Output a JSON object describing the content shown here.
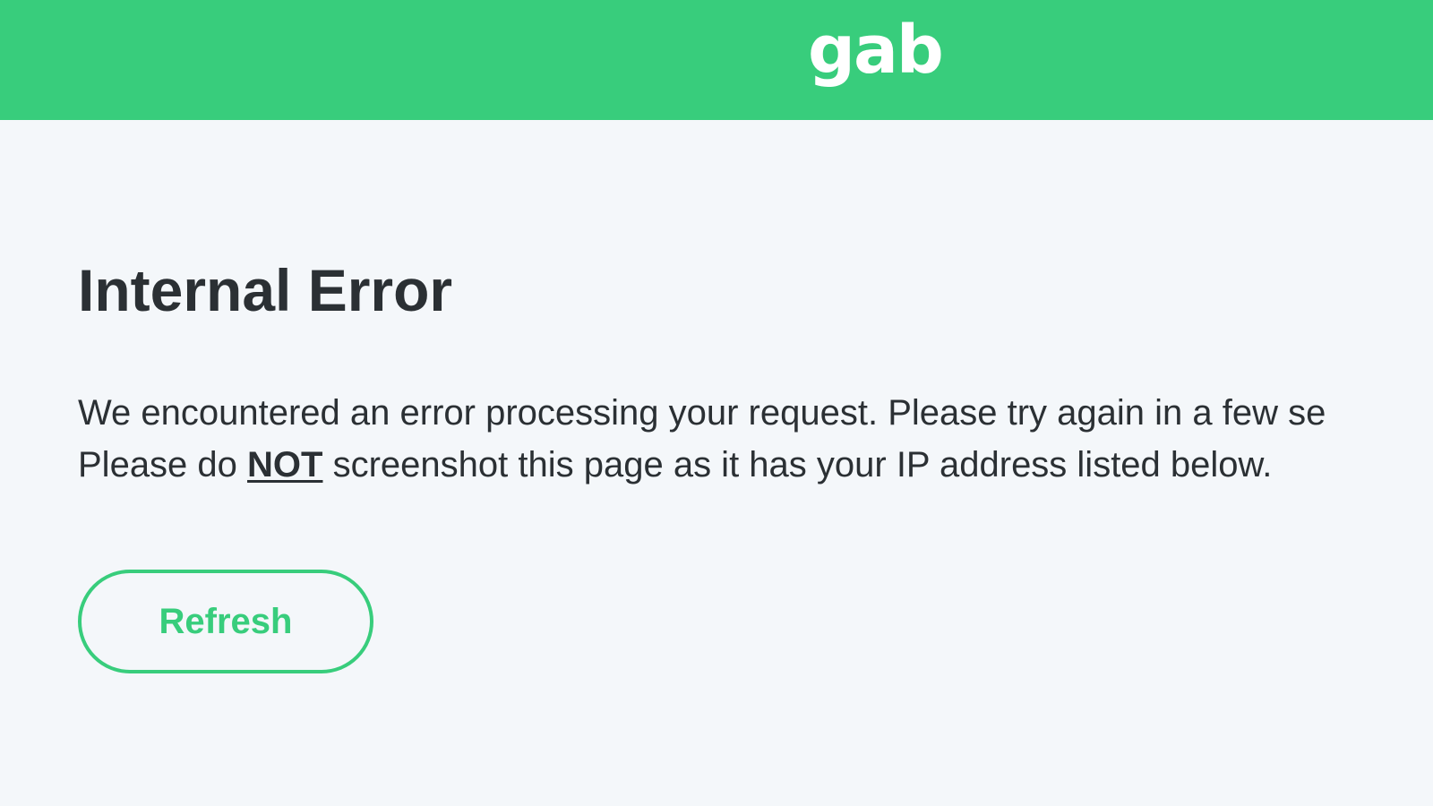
{
  "header": {
    "logo_text": "gab",
    "background_color": "#38cd7c"
  },
  "error": {
    "title": "Internal Error",
    "message_line1": "We encountered an error processing your request. Please try again in a few se",
    "message_line2_before": "Please do ",
    "message_line2_emphasis": "NOT",
    "message_line2_after": " screenshot this page as it has your IP address listed below."
  },
  "actions": {
    "refresh_label": "Refresh"
  },
  "colors": {
    "accent": "#38cd7c",
    "page_background": "#f4f7fa",
    "text": "#2b3034"
  }
}
